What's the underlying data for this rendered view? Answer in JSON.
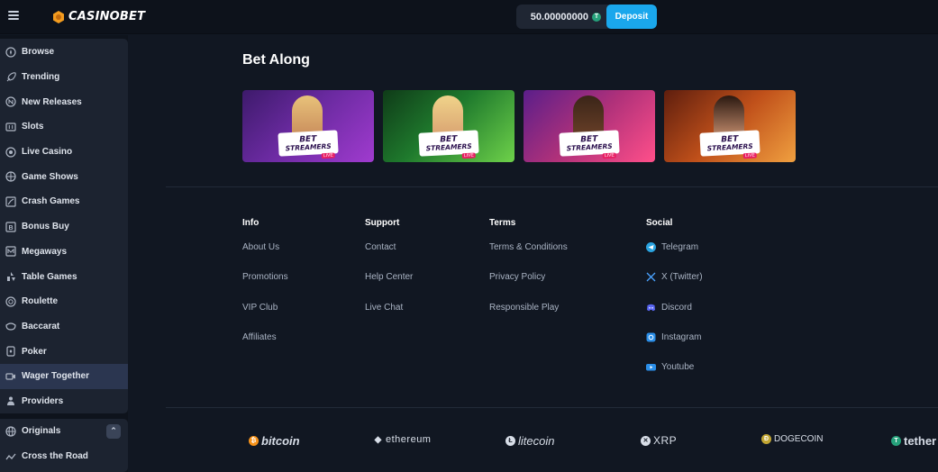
{
  "header": {
    "logo_text": "CASINOBET",
    "balance": "50.00000000",
    "currency_symbol": "T",
    "deposit_label": "Deposit"
  },
  "sidebar": {
    "items": [
      {
        "label": "Browse",
        "icon": "compass-icon"
      },
      {
        "label": "Trending",
        "icon": "rocket-icon"
      },
      {
        "label": "New Releases",
        "icon": "new-badge-icon"
      },
      {
        "label": "Slots",
        "icon": "slot-machine-icon"
      },
      {
        "label": "Live Casino",
        "icon": "live-icon"
      },
      {
        "label": "Game Shows",
        "icon": "game-show-icon"
      },
      {
        "label": "Crash Games",
        "icon": "crash-chart-icon"
      },
      {
        "label": "Bonus Buy",
        "icon": "bonus-icon"
      },
      {
        "label": "Megaways",
        "icon": "megaways-icon"
      },
      {
        "label": "Table Games",
        "icon": "table-games-icon"
      },
      {
        "label": "Roulette",
        "icon": "roulette-icon"
      },
      {
        "label": "Baccarat",
        "icon": "baccarat-icon"
      },
      {
        "label": "Poker",
        "icon": "poker-icon"
      },
      {
        "label": "Wager Together",
        "icon": "video-icon"
      },
      {
        "label": "Providers",
        "icon": "providers-icon"
      }
    ],
    "originals_label": "Originals",
    "cross_road_label": "Cross the Road"
  },
  "main": {
    "section_title": "Bet Along",
    "cards": [
      {
        "line1": "BET",
        "line2": "STREAMERS",
        "live": "LIVE"
      },
      {
        "line1": "BET",
        "line2": "STREAMERS",
        "live": "LIVE"
      },
      {
        "line1": "BET",
        "line2": "STREAMERS",
        "live": "LIVE"
      },
      {
        "line1": "BET",
        "line2": "STREAMERS",
        "live": "LIVE"
      }
    ]
  },
  "footer": {
    "info": {
      "title": "Info",
      "links": [
        "About Us",
        "Promotions",
        "VIP Club",
        "Affiliates"
      ]
    },
    "support": {
      "title": "Support",
      "links": [
        "Contact",
        "Help Center",
        "Live Chat"
      ]
    },
    "terms": {
      "title": "Terms",
      "links": [
        "Terms & Conditions",
        "Privacy Policy",
        "Responsible Play"
      ]
    },
    "social": {
      "title": "Social",
      "links": [
        "Telegram",
        "X (Twitter)",
        "Discord",
        "Instagram",
        "Youtube"
      ]
    }
  },
  "cryptos": [
    "bitcoin",
    "ethereum",
    "litecoin",
    "XRP",
    "DOGECOIN",
    "tether"
  ],
  "colors": {
    "accent": "#1aa7ec",
    "sidebar_active": "#2b3650",
    "background": "#111722"
  }
}
